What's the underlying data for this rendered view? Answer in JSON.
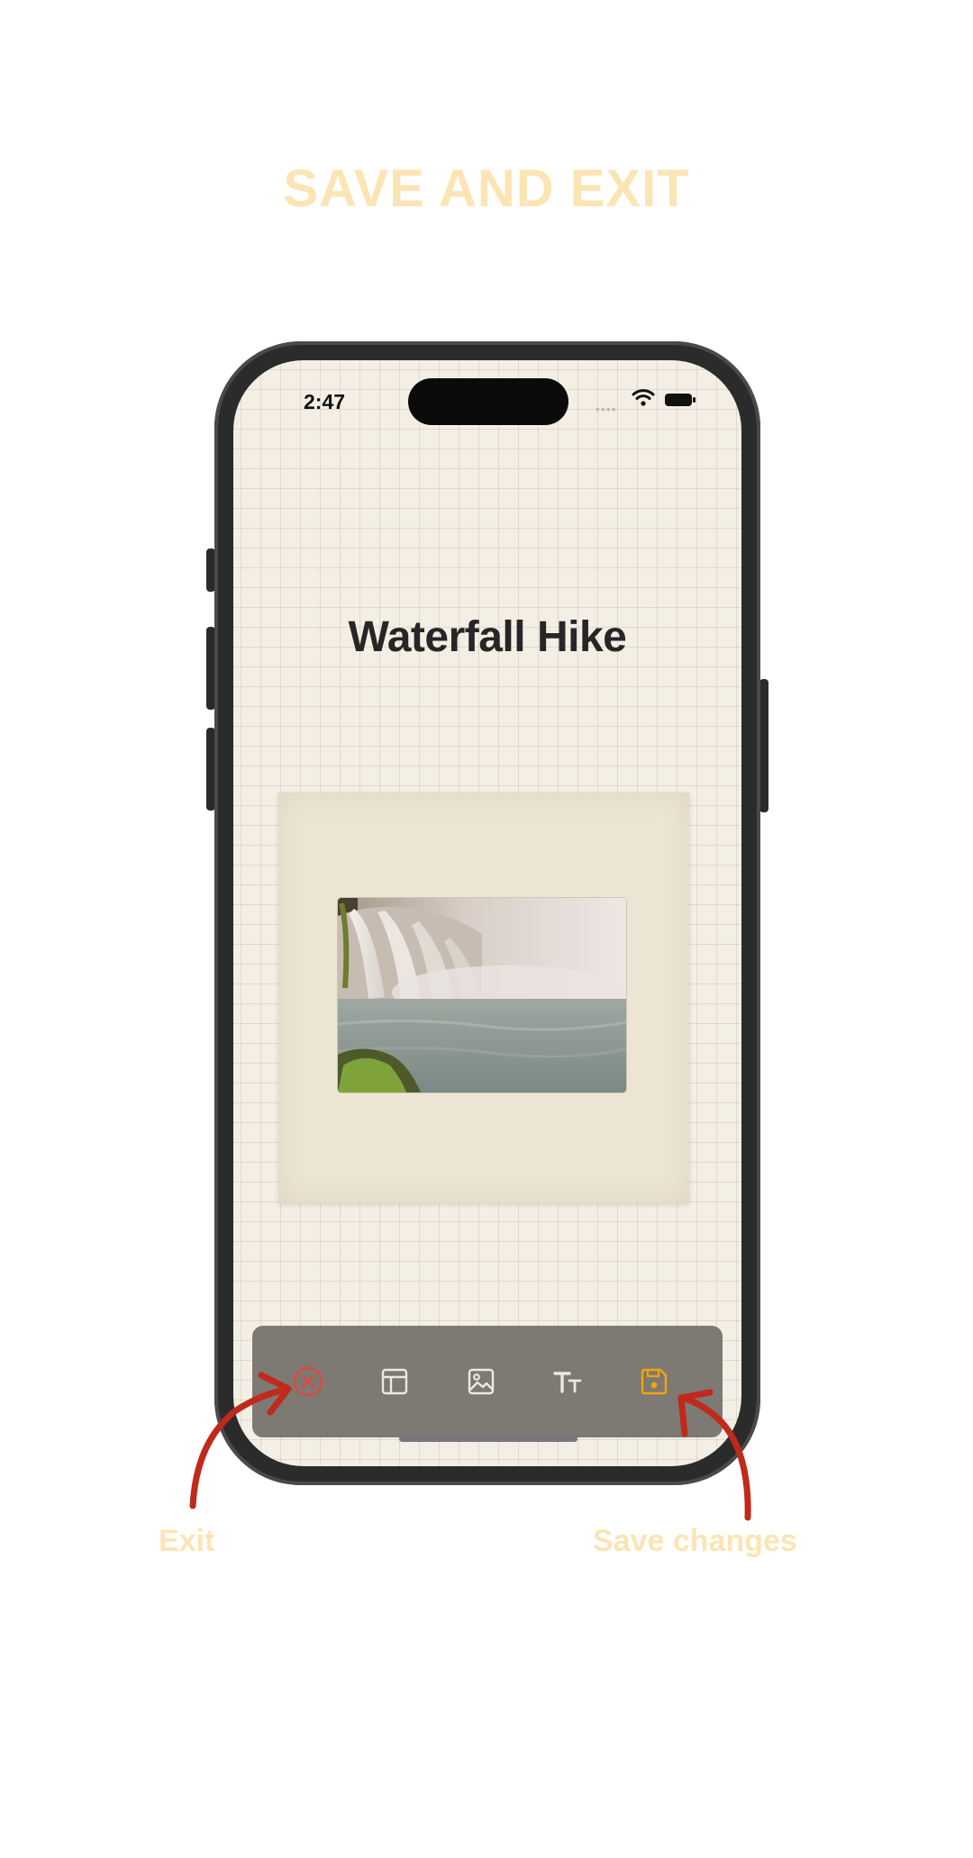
{
  "header": {
    "title": "SAVE AND EXIT"
  },
  "status_bar": {
    "time": "2:47"
  },
  "page": {
    "title": "Waterfall Hike"
  },
  "photo": {
    "subject": "waterfall-photo"
  },
  "toolbar": {
    "tools": [
      {
        "icon": "close-circle-icon",
        "color": "#E0483A"
      },
      {
        "icon": "layout-icon",
        "color": "#EDE8E0"
      },
      {
        "icon": "image-icon",
        "color": "#EDE8E0"
      },
      {
        "icon": "text-size-icon",
        "color": "#EDE8E0"
      },
      {
        "icon": "save-icon",
        "color": "#F2A40C"
      }
    ]
  },
  "annotations": {
    "exit_label": "Exit",
    "save_label": "Save changes",
    "label_color": "#FCE5B4",
    "arrow_color": "#C0291B"
  }
}
